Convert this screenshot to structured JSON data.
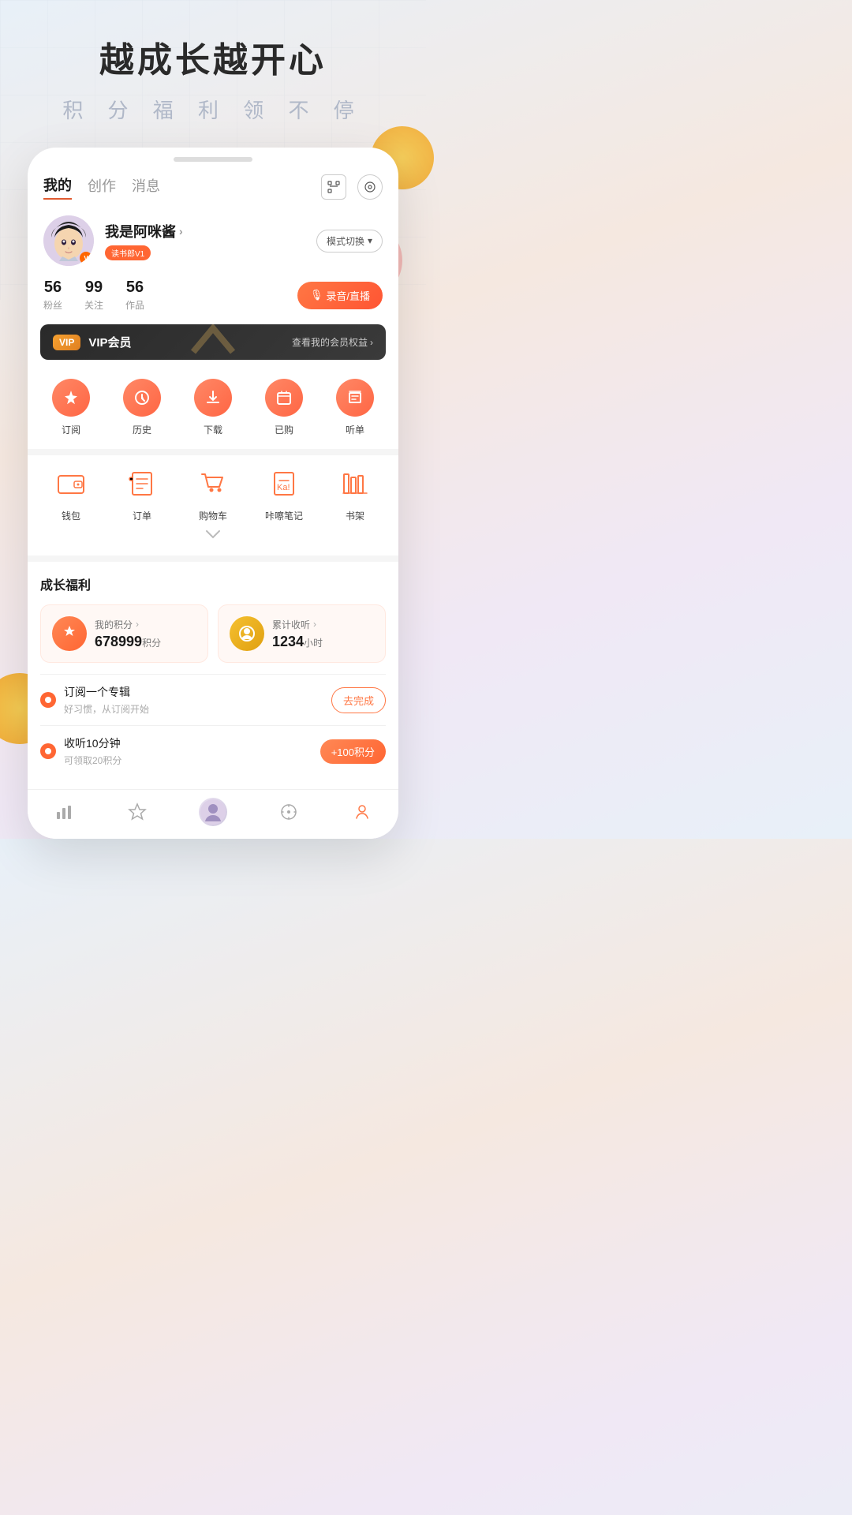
{
  "header": {
    "title": "越成长越开心",
    "subtitle": "积 分 福 利 领 不 停"
  },
  "tabs": {
    "items": [
      "我的",
      "创作",
      "消息"
    ],
    "active": "我的"
  },
  "tab_icons": {
    "scan": "⬜",
    "settings": "⊙"
  },
  "profile": {
    "name": "我是阿咪酱",
    "tag": "读书郎V1",
    "mode_switch": "模式切换",
    "fans_count": "56",
    "fans_label": "粉丝",
    "follow_count": "99",
    "follow_label": "关注",
    "works_count": "56",
    "works_label": "作品",
    "record_btn": "🎙 录音/直播"
  },
  "vip": {
    "badge": "VIP",
    "text": "VIP会员",
    "rights_link": "查看我的会员权益"
  },
  "quick_actions": [
    {
      "icon": "★",
      "label": "订阅"
    },
    {
      "icon": "⏱",
      "label": "历史"
    },
    {
      "icon": "↓",
      "label": "下载"
    },
    {
      "icon": "🛍",
      "label": "已购"
    },
    {
      "icon": "≡",
      "label": "听单"
    }
  ],
  "second_actions": [
    {
      "icon": "💳",
      "label": "钱包"
    },
    {
      "icon": "📋",
      "label": "订单"
    },
    {
      "icon": "🛒",
      "label": "购物车"
    },
    {
      "icon": "✏",
      "label": "咔嚓笔记"
    },
    {
      "icon": "📚",
      "label": "书架"
    }
  ],
  "growth": {
    "section_title": "成长福利",
    "points_label": "我的积分",
    "points_value": "678999",
    "points_unit": "积分",
    "listen_label": "累计收听",
    "listen_value": "1234",
    "listen_unit": "小时"
  },
  "tasks": [
    {
      "title": "订阅一个专辑",
      "desc": "好习惯，从订阅开始",
      "btn_label": "去完成",
      "btn_type": "outline"
    },
    {
      "title": "收听10分钟",
      "desc": "可领取20积分",
      "btn_label": "+100积分",
      "btn_type": "filled"
    }
  ],
  "bottom_nav": [
    {
      "icon": "chart",
      "label": ""
    },
    {
      "icon": "star",
      "label": ""
    },
    {
      "icon": "avatar",
      "label": ""
    },
    {
      "icon": "compass",
      "label": ""
    },
    {
      "icon": "person",
      "label": ""
    }
  ]
}
